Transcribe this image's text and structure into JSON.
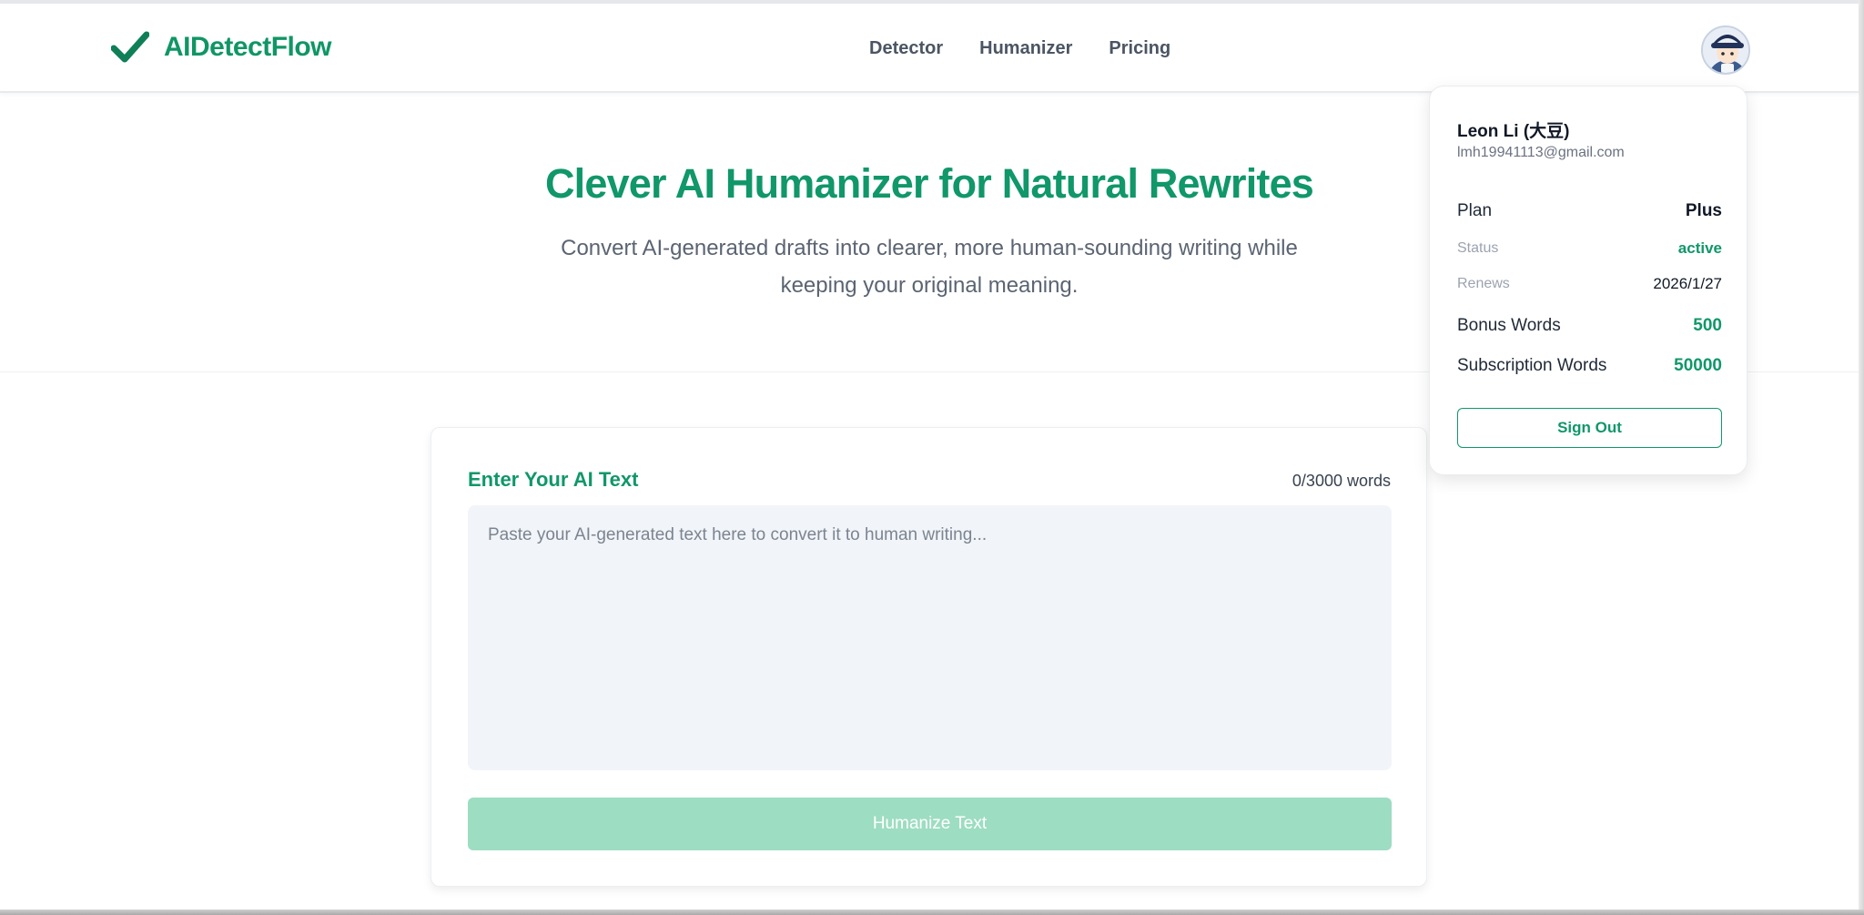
{
  "brand": {
    "name": "AIDetectFlow",
    "accent": "#10976a"
  },
  "nav": {
    "items": [
      "Detector",
      "Humanizer",
      "Pricing"
    ]
  },
  "hero": {
    "title": "Clever AI Humanizer for Natural Rewrites",
    "subtitle": "Convert AI-generated drafts into clearer, more human-sounding writing while keeping your original meaning."
  },
  "editor": {
    "heading": "Enter Your AI Text",
    "word_count": "0/3000 words",
    "placeholder": "Paste your AI-generated text here to convert it to human writing...",
    "value": "",
    "button_label": "Humanize Text"
  },
  "account": {
    "name": "Leon Li (大豆)",
    "email": "lmh19941113@gmail.com",
    "plan_label": "Plan",
    "plan_value": "Plus",
    "status_label": "Status",
    "status_value": "active",
    "renews_label": "Renews",
    "renews_value": "2026/1/27",
    "bonus_label": "Bonus Words",
    "bonus_value": "500",
    "subscription_label": "Subscription Words",
    "subscription_value": "50000",
    "sign_out_label": "Sign Out"
  },
  "icons": {
    "logo": "checkmark-icon",
    "avatar": "user-avatar"
  }
}
